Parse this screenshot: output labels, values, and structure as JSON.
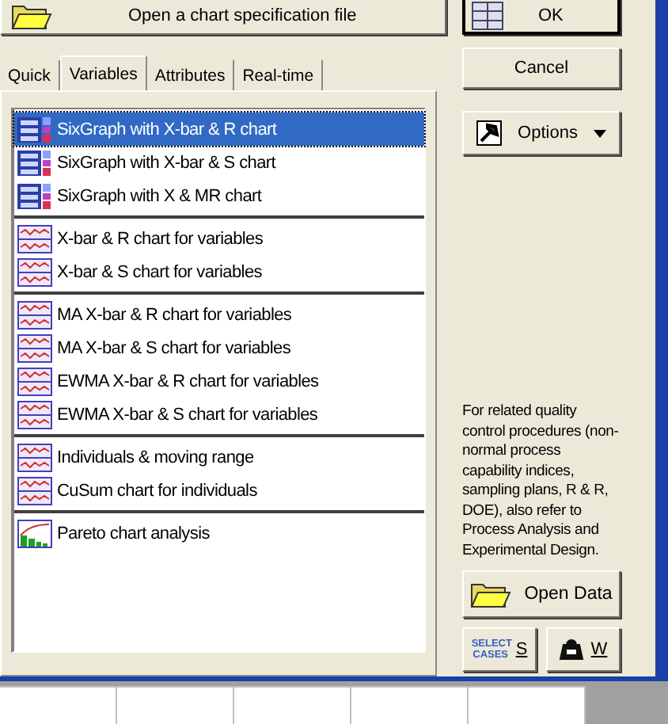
{
  "open_spec_button": {
    "label": "Open a chart specification file"
  },
  "ok_button": {
    "label": "OK"
  },
  "cancel_button": {
    "label": "Cancel"
  },
  "tabs": [
    {
      "label": "Quick",
      "selected": false
    },
    {
      "label": "Variables",
      "selected": true
    },
    {
      "label": "Attributes",
      "selected": false
    },
    {
      "label": "Real-time",
      "selected": false
    }
  ],
  "options_button": {
    "label": "Options"
  },
  "chart_groups": [
    [
      {
        "label": "SixGraph with X-bar & R chart",
        "kind": "sixgraph",
        "selected": true
      },
      {
        "label": "SixGraph with X-bar & S chart",
        "kind": "sixgraph",
        "selected": false
      },
      {
        "label": "SixGraph with X & MR chart",
        "kind": "sixgraph",
        "selected": false
      }
    ],
    [
      {
        "label": "X-bar & R chart for variables",
        "kind": "control",
        "selected": false
      },
      {
        "label": "X-bar & S chart for variables",
        "kind": "control",
        "selected": false
      }
    ],
    [
      {
        "label": "MA X-bar & R chart for variables",
        "kind": "control",
        "selected": false
      },
      {
        "label": "MA X-bar & S chart for variables",
        "kind": "control",
        "selected": false
      },
      {
        "label": "EWMA X-bar & R chart for variables",
        "kind": "control",
        "selected": false
      },
      {
        "label": "EWMA X-bar & S chart for variables",
        "kind": "control",
        "selected": false
      }
    ],
    [
      {
        "label": "Individuals & moving range",
        "kind": "control",
        "selected": false
      },
      {
        "label": "CuSum chart for individuals",
        "kind": "control",
        "selected": false
      }
    ],
    [
      {
        "label": "Pareto chart analysis",
        "kind": "pareto",
        "selected": false
      }
    ]
  ],
  "info_text": "For related quality control procedures (non-normal process capability indices, sampling plans, R & R, DOE), also refer to Process Analysis and Experimental Design.",
  "open_data_button": {
    "label": "Open Data"
  },
  "select_cases_button": {
    "icon_text": "SELECT CASES",
    "label": "S"
  },
  "weight_button": {
    "label": "W"
  }
}
